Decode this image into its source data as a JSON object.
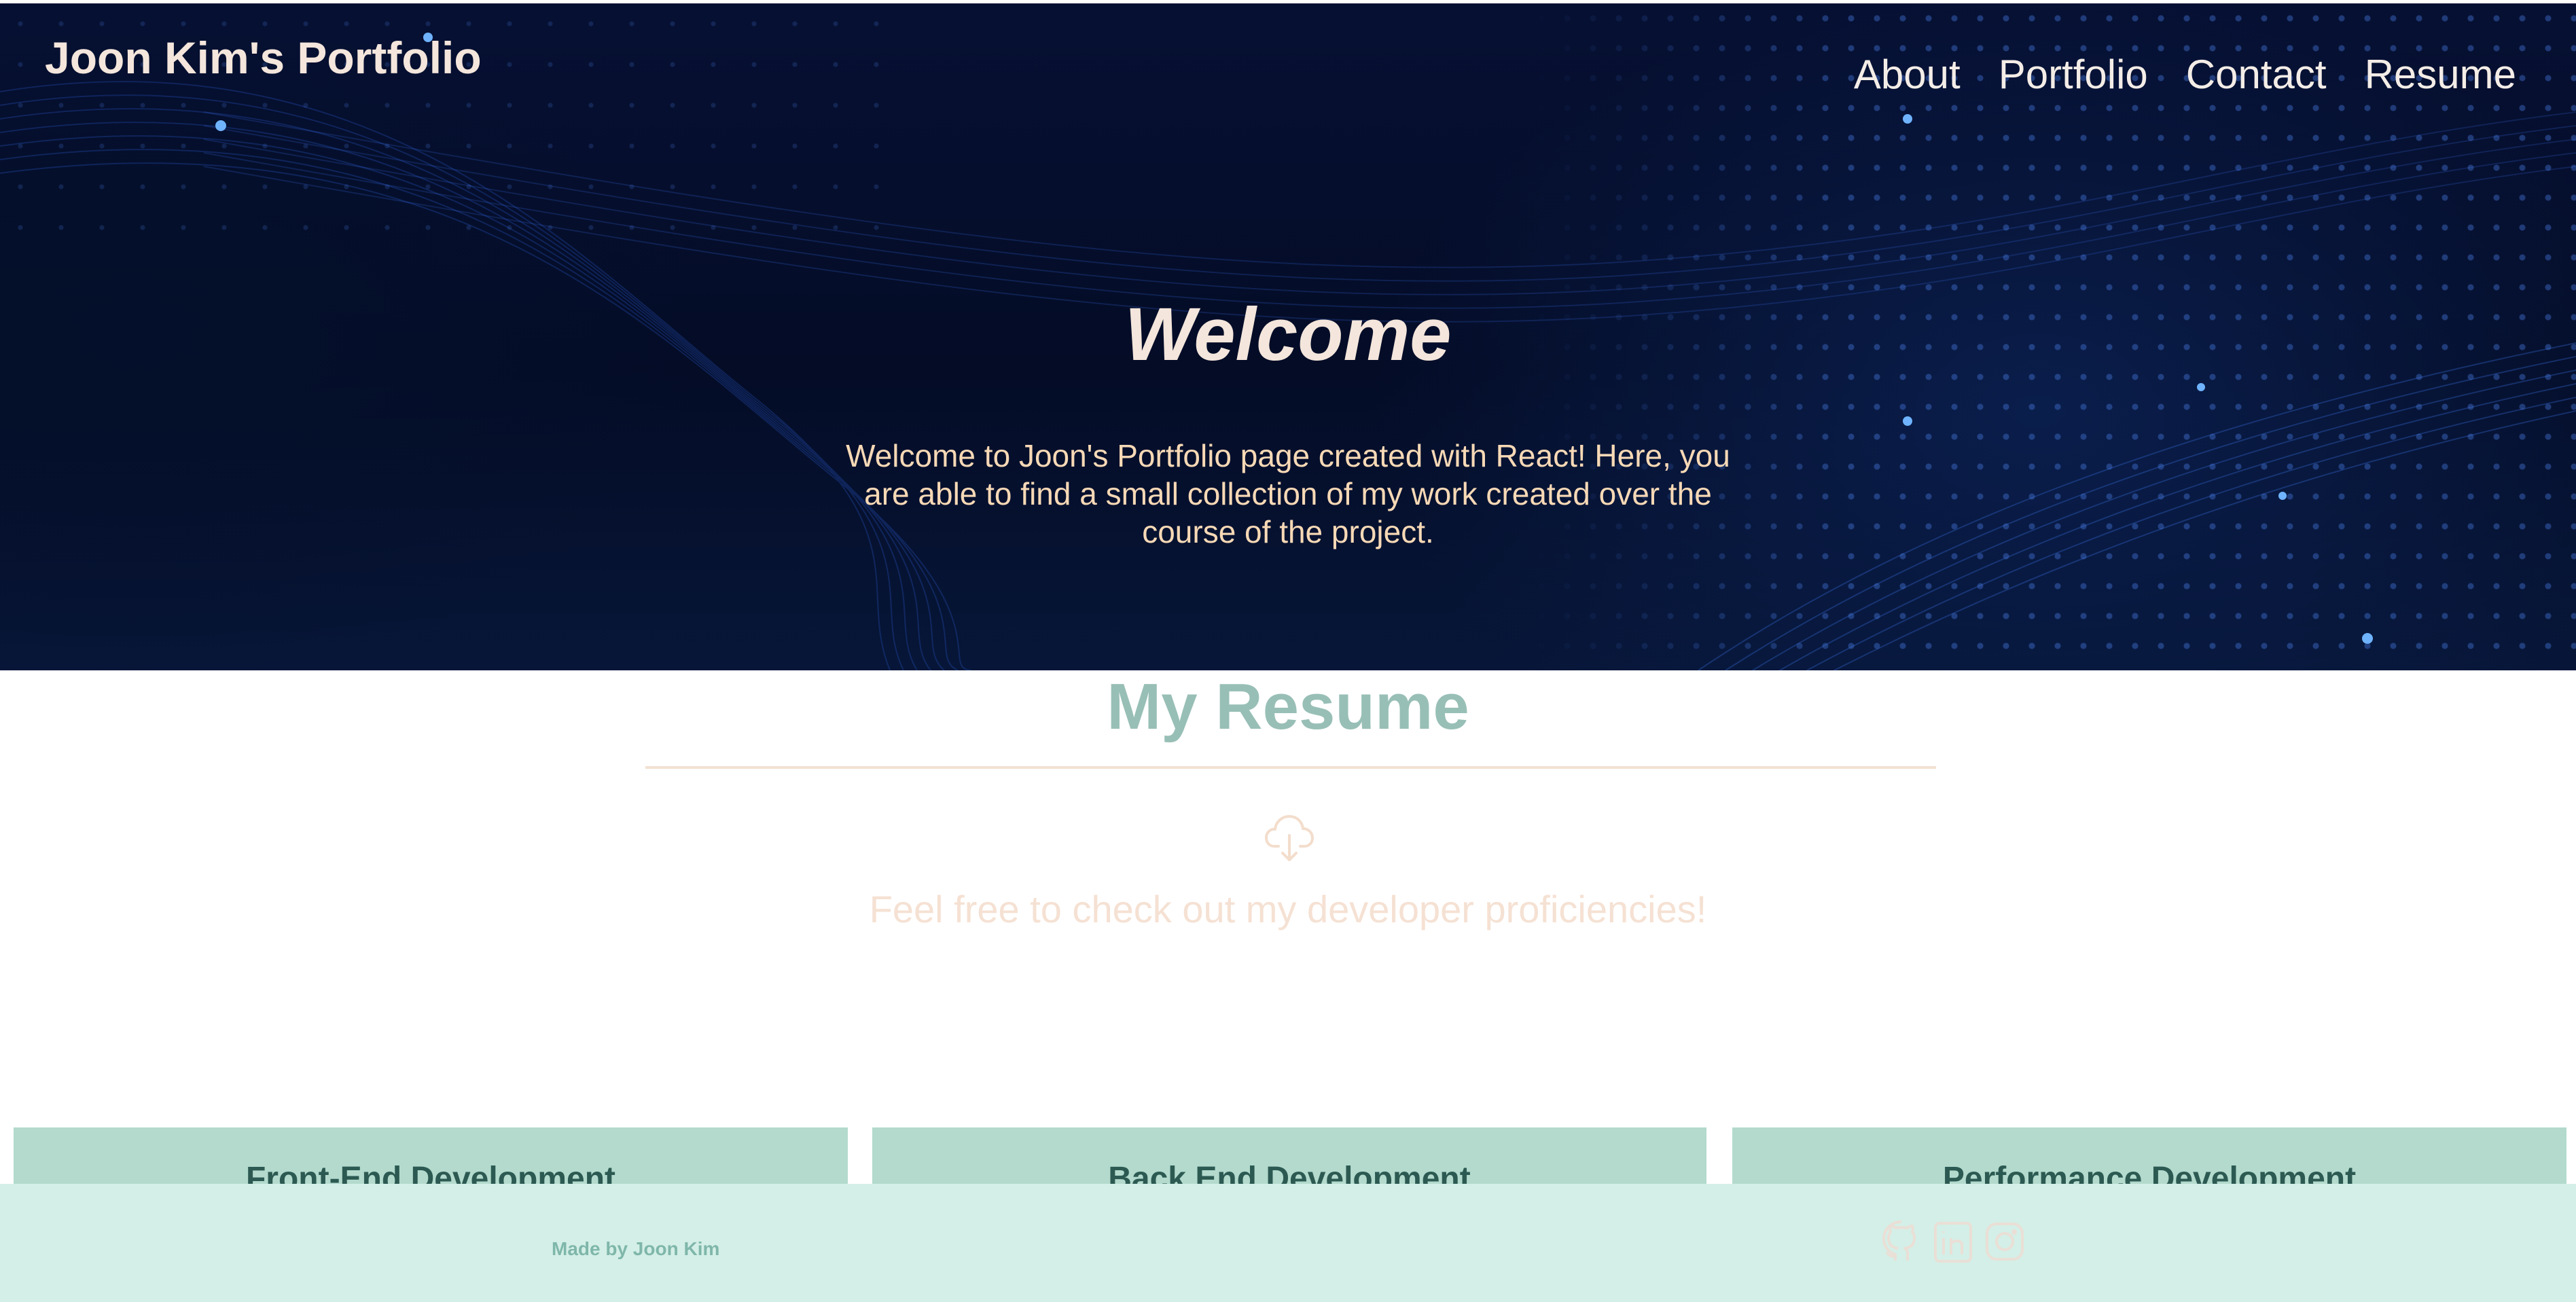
{
  "header": {
    "site_title": "Joon Kim's Portfolio",
    "nav": [
      {
        "label": "About"
      },
      {
        "label": "Portfolio"
      },
      {
        "label": "Contact"
      },
      {
        "label": "Resume"
      }
    ]
  },
  "hero": {
    "heading": "Welcome",
    "text": "Welcome to Joon's Portfolio page created with React! Here, you are able to find a small collection of my work created over the course of the project."
  },
  "resume": {
    "title": "My Resume",
    "download_icon": "cloud-download-icon",
    "subtitle": "Feel free to check out my developer proficiencies!"
  },
  "cards": [
    {
      "title": "Front-End Development"
    },
    {
      "title": "Back End Development"
    },
    {
      "title": "Performance Development"
    }
  ],
  "footer": {
    "credit": "Made by Joon Kim",
    "icons": [
      "github-icon",
      "linkedin-icon",
      "instagram-icon"
    ]
  },
  "colors": {
    "hero_bg": "#061033",
    "title_text": "#f4e6dc",
    "hero_body_text": "#f8d9b6",
    "resume_title": "#98bfb6",
    "card_bg": "#b3dacd",
    "card_text": "#2c5a52",
    "footer_bg": "#d4efe7",
    "footer_text": "#7fb7aa"
  }
}
